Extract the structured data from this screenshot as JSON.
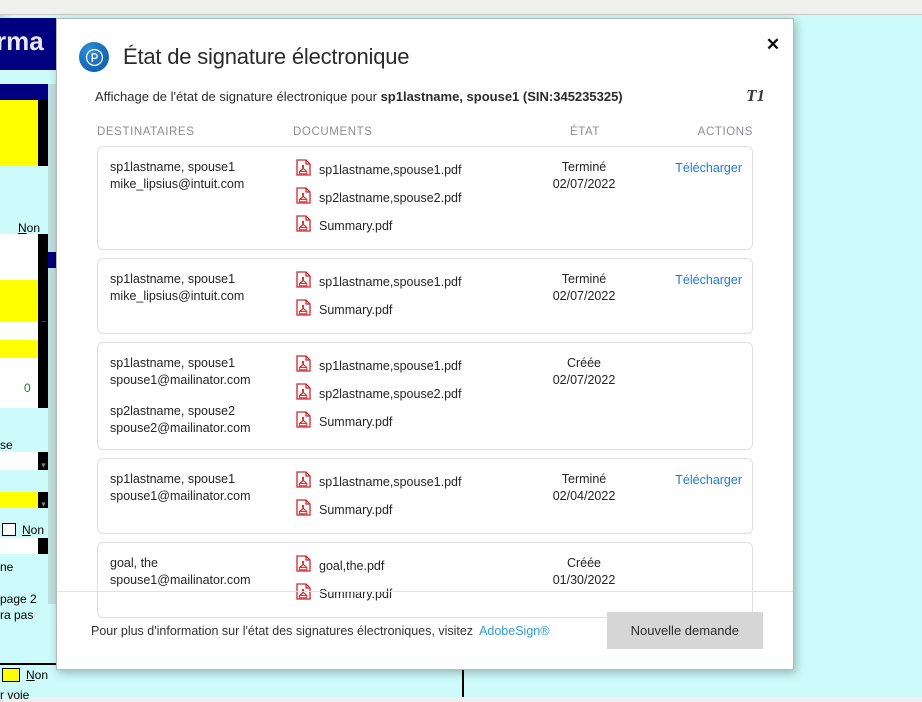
{
  "background": {
    "form_title_fragment": "rma",
    "cells": [
      {
        "text": "Non",
        "kind": "checkbox-label"
      },
      {
        "text": "0",
        "kind": "value-green"
      },
      {
        "text": "se",
        "kind": "text"
      },
      {
        "text": "Non",
        "kind": "checkbox-label"
      },
      {
        "text": "ne",
        "kind": "text"
      },
      {
        "text": "page 2",
        "kind": "text"
      },
      {
        "text": "ra pas",
        "kind": "text"
      },
      {
        "text": "Non",
        "kind": "checkbox-label"
      },
      {
        "text": "r voie",
        "kind": "text"
      }
    ]
  },
  "modal": {
    "close_label": "✕",
    "logo_icon": "pro-connect-circle-icon",
    "title": "État de signature électronique",
    "subtitle_prefix": "Affichage de l'état de signature électronique pour ",
    "subtitle_subject": "sp1lastname, spouse1 (SIN:345235325)",
    "form_tag": "T1",
    "columns": {
      "recipients": "DESTINATAIRES",
      "documents": "DOCUMENTS",
      "status": "ÉTAT",
      "actions": "ACTIONS"
    },
    "rows": [
      {
        "recipients": [
          {
            "name": "sp1lastname, spouse1",
            "email": "mike_lipsius@intuit.com"
          }
        ],
        "documents": [
          "sp1lastname,spouse1.pdf",
          "sp2lastname,spouse2.pdf",
          "Summary.pdf"
        ],
        "status": "Terminé",
        "date": "02/07/2022",
        "action": "Télécharger"
      },
      {
        "recipients": [
          {
            "name": "sp1lastname, spouse1",
            "email": "mike_lipsius@intuit.com"
          }
        ],
        "documents": [
          "sp1lastname,spouse1.pdf",
          "Summary.pdf"
        ],
        "status": "Terminé",
        "date": "02/07/2022",
        "action": "Télécharger"
      },
      {
        "recipients": [
          {
            "name": "sp1lastname, spouse1",
            "email": "spouse1@mailinator.com"
          },
          {
            "name": "sp2lastname, spouse2",
            "email": "spouse2@mailinator.com"
          }
        ],
        "documents": [
          "sp1lastname,spouse1.pdf",
          "sp2lastname,spouse2.pdf",
          "Summary.pdf"
        ],
        "status": "Créée",
        "date": "02/07/2022",
        "action": ""
      },
      {
        "recipients": [
          {
            "name": "sp1lastname, spouse1",
            "email": "spouse1@mailinator.com"
          }
        ],
        "documents": [
          "sp1lastname,spouse1.pdf",
          "Summary.pdf"
        ],
        "status": "Terminé",
        "date": "02/04/2022",
        "action": "Télécharger"
      },
      {
        "recipients": [
          {
            "name": "goal, the",
            "email": "spouse1@mailinator.com"
          }
        ],
        "documents": [
          "goal,the.pdf",
          "Summary.pdf"
        ],
        "status": "Créée",
        "date": "01/30/2022",
        "action": ""
      }
    ],
    "footer": {
      "text": "Pour plus d'information sur l'état des signatures électroniques, visitez",
      "link": "AdobeSign®",
      "button": "Nouvelle demande"
    }
  },
  "colors": {
    "link": "#1f7ad4",
    "footer_link": "#2e9fd6",
    "pdf_icon": "#d5252b",
    "canvas": "#cdfbfb",
    "form_header": "#000080",
    "highlight": "#ffff00"
  }
}
